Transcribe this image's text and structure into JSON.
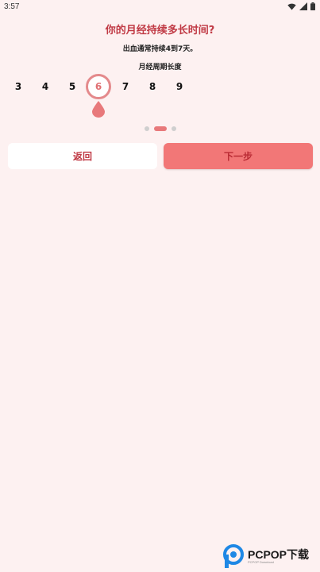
{
  "status_bar": {
    "time": "3:57"
  },
  "question": {
    "title": "你的月经持续多长时间?",
    "hint": "出血通常持续4到7天。",
    "cycle_label": "月经周期长度"
  },
  "day_picker": {
    "options": [
      "3",
      "4",
      "5",
      "6",
      "7",
      "8",
      "9"
    ],
    "selected": "6"
  },
  "pager": {
    "total": 3,
    "current": 2
  },
  "buttons": {
    "back": "返回",
    "next": "下一步"
  },
  "watermark": {
    "brand": "PCPOP下载",
    "subtitle": "PCPOP Download"
  },
  "colors": {
    "background": "#fdf1f1",
    "accent": "#e8797b",
    "title": "#c03a45",
    "next_button": "#f27777"
  }
}
